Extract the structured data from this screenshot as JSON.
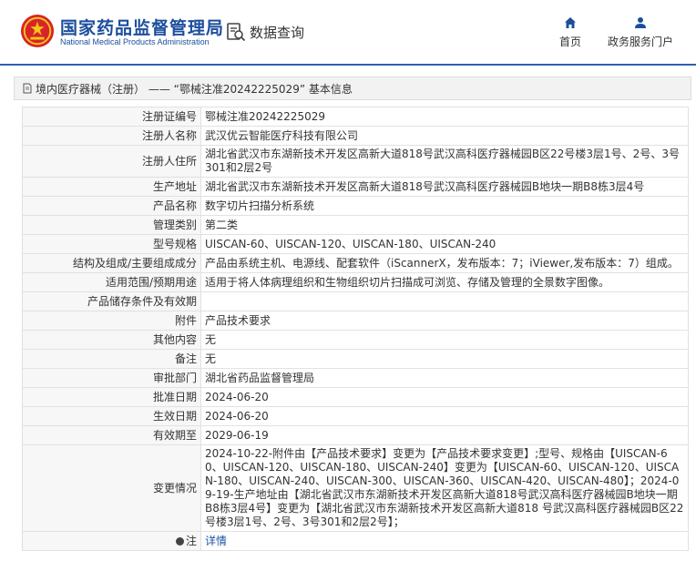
{
  "header": {
    "site_name_cn": "国家药品监督管理局",
    "site_name_en": "National Medical Products Administration",
    "query_label": "数据查询",
    "nav_home": "首页",
    "nav_portal": "政务服务门户"
  },
  "breadcrumb": {
    "text": "境内医疗器械（注册） —— “鄂械注准20242225029” 基本信息"
  },
  "rows": [
    {
      "label": "注册证编号",
      "value": "鄂械注准20242225029"
    },
    {
      "label": "注册人名称",
      "value": "武汉优云智能医疗科技有限公司"
    },
    {
      "label": "注册人住所",
      "value": "湖北省武汉市东湖新技术开发区高新大道818号武汉高科医疗器械园B区22号楼3层1号、2号、3号301和2层2号"
    },
    {
      "label": "生产地址",
      "value": "湖北省武汉市东湖新技术开发区高新大道818号武汉高科医疗器械园B地块一期B8栋3层4号"
    },
    {
      "label": "产品名称",
      "value": "数字切片扫描分析系统"
    },
    {
      "label": "管理类别",
      "value": "第二类"
    },
    {
      "label": "型号规格",
      "value": "UISCAN-60、UISCAN-120、UISCAN-180、UISCAN-240"
    },
    {
      "label": "结构及组成/主要组成成分",
      "value": "产品由系统主机、电源线、配套软件（iScannerX，发布版本：7；iViewer,发布版本：7）组成。"
    },
    {
      "label": "适用范围/预期用途",
      "value": "适用于将人体病理组织和生物组织切片扫描成可浏览、存储及管理的全景数字图像。"
    },
    {
      "label": "产品储存条件及有效期",
      "value": ""
    },
    {
      "label": "附件",
      "value": "产品技术要求"
    },
    {
      "label": "其他内容",
      "value": "无"
    },
    {
      "label": "备注",
      "value": "无"
    },
    {
      "label": "审批部门",
      "value": "湖北省药品监督管理局"
    },
    {
      "label": "批准日期",
      "value": "2024-06-20"
    },
    {
      "label": "生效日期",
      "value": "2024-06-20"
    },
    {
      "label": "有效期至",
      "value": "2029-06-19"
    },
    {
      "label": "变更情况",
      "value": "2024-10-22-附件由【产品技术要求】变更为【产品技术要求变更】;型号、规格由【UISCAN-60、UISCAN-120、UISCAN-180、UISCAN-240】变更为【UISCAN-60、UISCAN-120、UISCAN-180、UISCAN-240、UISCAN-300、UISCAN-360、UISCAN-420、UISCAN-480】；2024-09-19-生产地址由【湖北省武汉市东湖新技术开发区高新大道818号武汉高科医疗器械园B地块一期B8栋3层4号】变更为【湖北省武汉市东湖新技术开发区高新大道818 号武汉高科医疗器械园B区22号楼3层1号、2号、3号301和2层2号】；"
    }
  ],
  "note_row": {
    "label": "注",
    "link_text": "详情"
  },
  "colors": {
    "brand_blue": "#1b4e9c",
    "divider": "#2a62b3",
    "link": "#1a56a8"
  },
  "icons": [
    "national-emblem-icon",
    "data-query-icon",
    "home-icon",
    "user-icon",
    "document-icon",
    "note-icon"
  ]
}
